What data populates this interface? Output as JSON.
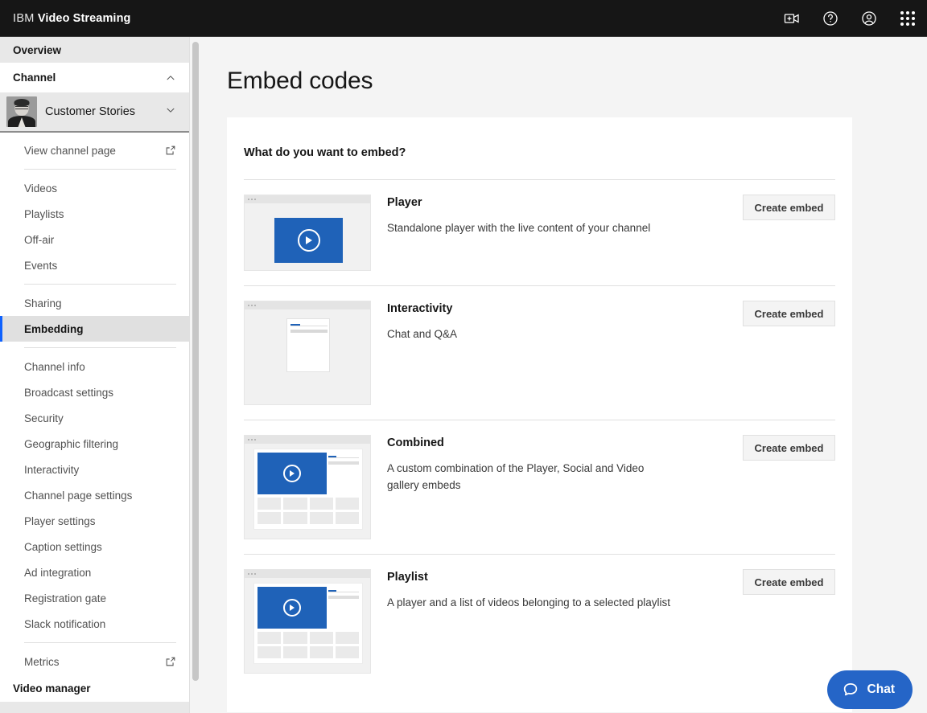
{
  "header": {
    "brand_prefix": "IBM",
    "brand_name": "Video Streaming",
    "actions": [
      {
        "name": "add-video-icon",
        "label": "Add video"
      },
      {
        "name": "help-icon",
        "label": "Help"
      },
      {
        "name": "account-icon",
        "label": "Account"
      },
      {
        "name": "app-switcher-icon",
        "label": "App switcher"
      }
    ]
  },
  "sidebar": {
    "overview_label": "Overview",
    "channel_label": "Channel",
    "channel_name": "Customer Stories",
    "view_channel_page": "View channel page",
    "group_one": [
      "Videos",
      "Playlists",
      "Off-air",
      "Events"
    ],
    "group_two": [
      "Sharing",
      "Embedding"
    ],
    "active_item": "Embedding",
    "group_three": [
      "Channel info",
      "Broadcast settings",
      "Security",
      "Geographic filtering",
      "Interactivity",
      "Channel page settings",
      "Player settings",
      "Caption settings",
      "Ad integration",
      "Registration gate",
      "Slack notification"
    ],
    "metrics_label": "Metrics",
    "video_manager_label": "Video manager"
  },
  "main": {
    "page_title": "Embed codes",
    "card_heading": "What do you want to embed?",
    "button_label": "Create embed",
    "rows": [
      {
        "title": "Player",
        "desc": "Standalone player with the live content of your channel",
        "thumb": "player"
      },
      {
        "title": "Interactivity",
        "desc": "Chat and Q&A",
        "thumb": "interactivity"
      },
      {
        "title": "Combined",
        "desc": "A custom combination of the Player, Social and Video gallery embeds",
        "thumb": "combined"
      },
      {
        "title": "Playlist",
        "desc": "A player and a list of videos belonging to a selected playlist",
        "thumb": "playlist"
      }
    ]
  },
  "chat": {
    "label": "Chat"
  },
  "colors": {
    "header_bg": "#161616",
    "accent_blue": "#0f62fe",
    "thumb_blue": "#1f62b8",
    "chat_blue": "#2565c7",
    "page_bg": "#f4f4f4",
    "card_bg": "#ffffff",
    "active_bg": "#e0e0e0"
  }
}
